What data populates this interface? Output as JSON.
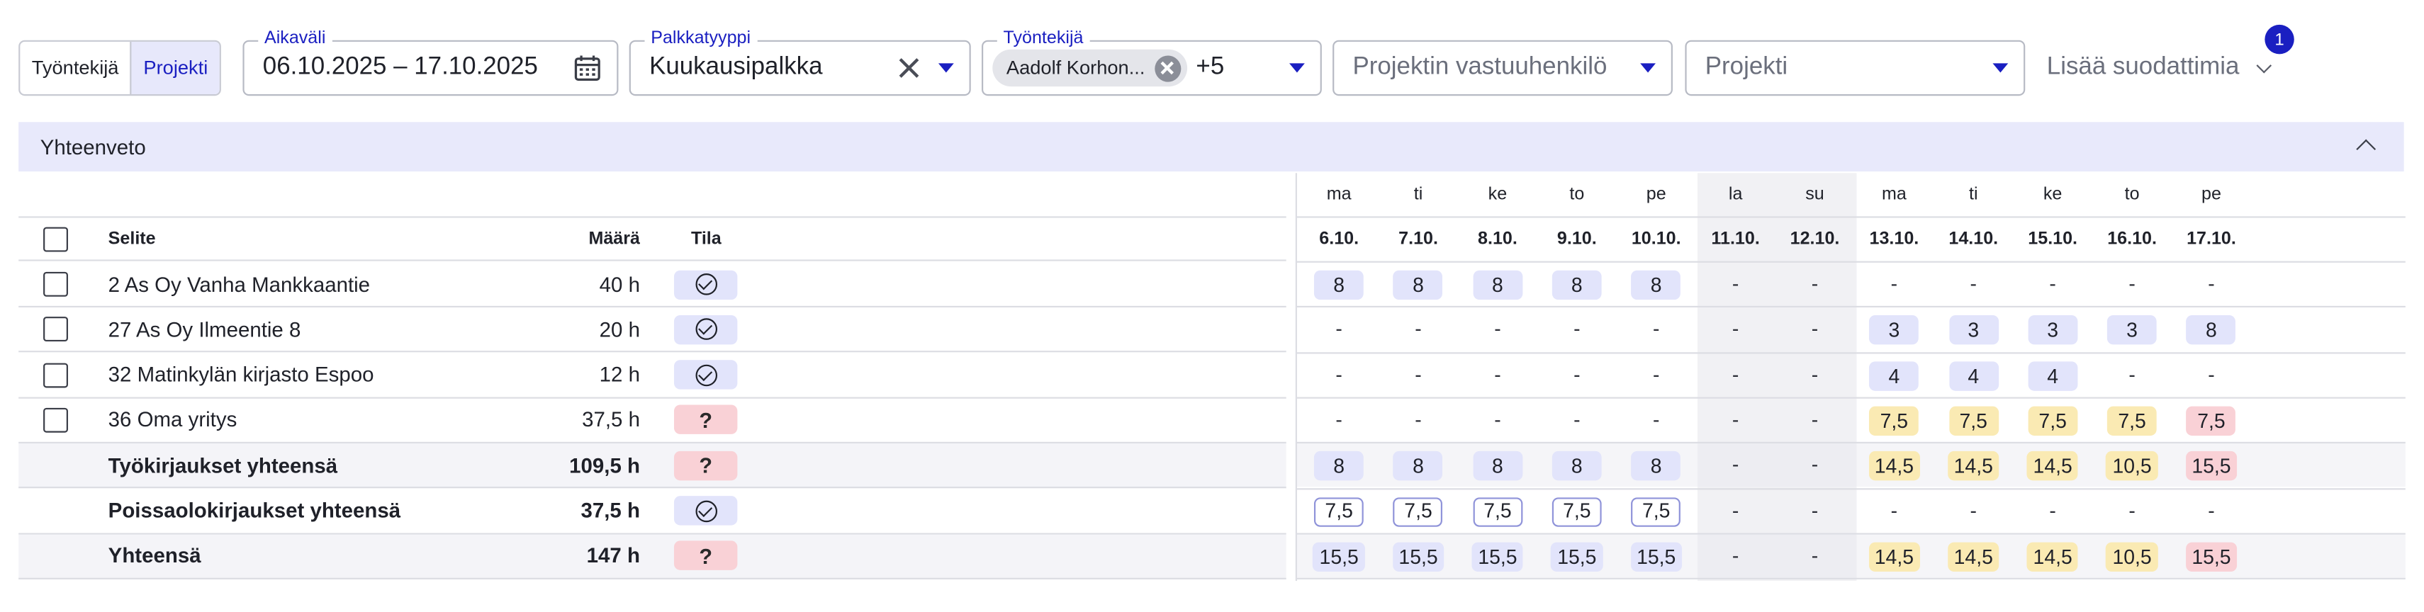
{
  "view_toggle": {
    "options": [
      "Työntekijä",
      "Projekti"
    ],
    "active": "Projekti"
  },
  "filters": {
    "date_range": {
      "label": "Aikaväli",
      "value": "06.10.2025 – 17.10.2025"
    },
    "salary_type": {
      "label": "Palkkatyyppi",
      "value": "Kuukausipalkka"
    },
    "employee": {
      "label": "Työntekijä",
      "chip": "Aadolf Korhon...",
      "more": "+5"
    },
    "project_manager": {
      "placeholder": "Projektin vastuuhenkilö"
    },
    "project": {
      "placeholder": "Projekti"
    },
    "more_filters": {
      "label": "Lisää suodattimia",
      "badge": "1"
    }
  },
  "summary": {
    "title": "Yhteenveto"
  },
  "table": {
    "headers": {
      "description": "Selite",
      "quantity": "Määrä",
      "status": "Tila"
    },
    "rows": [
      {
        "description": "2 As Oy Vanha Mankkaantie",
        "quantity": "40 h",
        "status": "ok",
        "checkbox": true,
        "total": false,
        "days": [
          [
            "8",
            "blue"
          ],
          [
            "8",
            "blue"
          ],
          [
            "8",
            "blue"
          ],
          [
            "8",
            "blue"
          ],
          [
            "8",
            "blue"
          ],
          [
            "-",
            ""
          ],
          [
            "-",
            ""
          ],
          [
            "-",
            ""
          ],
          [
            "-",
            ""
          ],
          [
            "-",
            ""
          ],
          [
            "-",
            ""
          ],
          [
            "-",
            ""
          ]
        ]
      },
      {
        "description": "27 As Oy Ilmeentie 8",
        "quantity": "20 h",
        "status": "ok",
        "checkbox": true,
        "total": false,
        "days": [
          [
            "-",
            ""
          ],
          [
            "-",
            ""
          ],
          [
            "-",
            ""
          ],
          [
            "-",
            ""
          ],
          [
            "-",
            ""
          ],
          [
            "-",
            ""
          ],
          [
            "-",
            ""
          ],
          [
            "3",
            "blue"
          ],
          [
            "3",
            "blue"
          ],
          [
            "3",
            "blue"
          ],
          [
            "3",
            "blue"
          ],
          [
            "8",
            "blue"
          ]
        ]
      },
      {
        "description": "32 Matinkylän kirjasto Espoo",
        "quantity": "12 h",
        "status": "ok",
        "checkbox": true,
        "total": false,
        "days": [
          [
            "-",
            ""
          ],
          [
            "-",
            ""
          ],
          [
            "-",
            ""
          ],
          [
            "-",
            ""
          ],
          [
            "-",
            ""
          ],
          [
            "-",
            ""
          ],
          [
            "-",
            ""
          ],
          [
            "4",
            "blue"
          ],
          [
            "4",
            "blue"
          ],
          [
            "4",
            "blue"
          ],
          [
            "-",
            ""
          ],
          [
            "-",
            ""
          ]
        ]
      },
      {
        "description": "36 Oma yritys",
        "quantity": "37,5 h",
        "status": "question",
        "checkbox": true,
        "total": false,
        "days": [
          [
            "-",
            ""
          ],
          [
            "-",
            ""
          ],
          [
            "-",
            ""
          ],
          [
            "-",
            ""
          ],
          [
            "-",
            ""
          ],
          [
            "-",
            ""
          ],
          [
            "-",
            ""
          ],
          [
            "7,5",
            "yellow"
          ],
          [
            "7,5",
            "yellow"
          ],
          [
            "7,5",
            "yellow"
          ],
          [
            "7,5",
            "yellow"
          ],
          [
            "7,5",
            "red"
          ]
        ]
      },
      {
        "description": "Työkirjaukset yhteensä",
        "quantity": "109,5 h",
        "status": "question",
        "checkbox": false,
        "total": true,
        "days": [
          [
            "8",
            "blue"
          ],
          [
            "8",
            "blue"
          ],
          [
            "8",
            "blue"
          ],
          [
            "8",
            "blue"
          ],
          [
            "8",
            "blue"
          ],
          [
            "-",
            ""
          ],
          [
            "-",
            ""
          ],
          [
            "14,5",
            "yellow"
          ],
          [
            "14,5",
            "yellow"
          ],
          [
            "14,5",
            "yellow"
          ],
          [
            "10,5",
            "yellow"
          ],
          [
            "15,5",
            "red"
          ]
        ]
      },
      {
        "description": "Poissaolokirjaukset yhteensä",
        "quantity": "37,5 h",
        "status": "ok",
        "checkbox": false,
        "total": false,
        "days": [
          [
            "7,5",
            "outline"
          ],
          [
            "7,5",
            "outline"
          ],
          [
            "7,5",
            "outline"
          ],
          [
            "7,5",
            "outline"
          ],
          [
            "7,5",
            "outline"
          ],
          [
            "-",
            ""
          ],
          [
            "-",
            ""
          ],
          [
            "-",
            ""
          ],
          [
            "-",
            ""
          ],
          [
            "-",
            ""
          ],
          [
            "-",
            ""
          ],
          [
            "-",
            ""
          ]
        ]
      },
      {
        "description": "Yhteensä",
        "quantity": "147 h",
        "status": "question",
        "checkbox": false,
        "total": true,
        "days": [
          [
            "15,5",
            "blue"
          ],
          [
            "15,5",
            "blue"
          ],
          [
            "15,5",
            "blue"
          ],
          [
            "15,5",
            "blue"
          ],
          [
            "15,5",
            "blue"
          ],
          [
            "-",
            ""
          ],
          [
            "-",
            ""
          ],
          [
            "14,5",
            "yellow"
          ],
          [
            "14,5",
            "yellow"
          ],
          [
            "14,5",
            "yellow"
          ],
          [
            "10,5",
            "yellow"
          ],
          [
            "15,5",
            "red"
          ]
        ]
      }
    ],
    "weekdays": [
      "ma",
      "ti",
      "ke",
      "to",
      "pe",
      "la",
      "su",
      "ma",
      "ti",
      "ke",
      "to",
      "pe"
    ],
    "dates": [
      "6.10.",
      "7.10.",
      "8.10.",
      "9.10.",
      "10.10.",
      "11.10.",
      "12.10.",
      "13.10.",
      "14.10.",
      "15.10.",
      "16.10.",
      "17.10."
    ],
    "status_icons": {
      "ok": "check-circle-icon",
      "question": "question-mark-icon"
    },
    "colors": {
      "accent": "#1a1fc1",
      "blue_cell": "#e2e4fb",
      "yellow_cell": "#faeab3",
      "red_cell": "#f9d1d6",
      "weekend": "#f1f1f4"
    }
  }
}
